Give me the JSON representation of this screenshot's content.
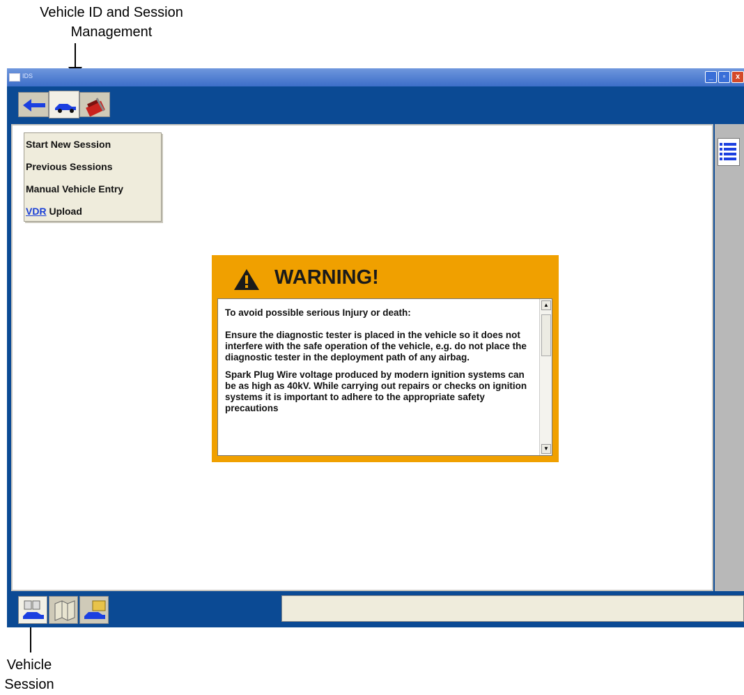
{
  "callouts": {
    "top_line1": "Vehicle ID and Session",
    "top_line2": "Management",
    "bottom_line1": "Vehicle",
    "bottom_line2": "Session"
  },
  "window": {
    "title": "IDS"
  },
  "top_tabs": [
    {
      "icon": "back-arrow-icon"
    },
    {
      "icon": "vehicle-icon"
    },
    {
      "icon": "toolbox-icon"
    }
  ],
  "session_menu": {
    "start_new": "Start New Session",
    "previous": "Previous Sessions",
    "manual": "Manual Vehicle Entry",
    "vdr_link": "VDR",
    "vdr_rest": " Upload"
  },
  "warning": {
    "title": "WARNING!",
    "paragraphs": [
      "To avoid possible serious Injury or death:",
      "Ensure the diagnostic tester is placed in the vehicle so it does not interfere with the safe operation of the vehicle, e.g. do not place the diagnostic tester in the deployment path of any airbag.",
      "Spark Plug Wire voltage produced by modern ignition systems can be as high as 40kV. While carrying out repairs or checks on ignition systems it is important to adhere to the appropriate safety precautions"
    ],
    "accent_color": "#f0a000"
  },
  "bottom_tabs": [
    {
      "icon": "vehicle-session-icon"
    },
    {
      "icon": "map-icon"
    },
    {
      "icon": "vehicle-folder-icon"
    }
  ],
  "colors": {
    "window_blue": "#0b4a94",
    "titlebar_blue": "#3c6ec8",
    "menu_bg": "#efecdc"
  }
}
